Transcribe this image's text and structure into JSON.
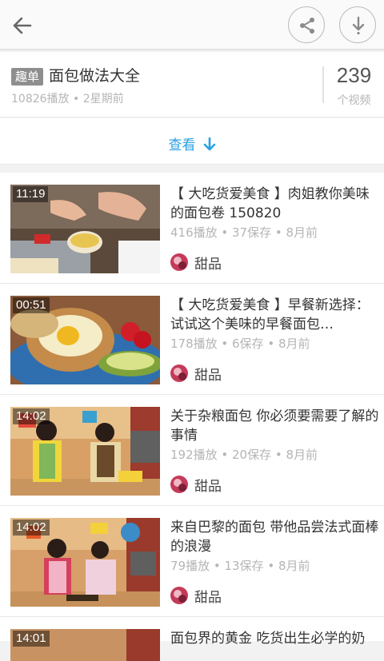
{
  "header": {
    "back_icon": "arrow-left-icon",
    "share_icon": "share-icon",
    "download_icon": "download-icon"
  },
  "playlist": {
    "tag": "趣单",
    "title": "面包做法大全",
    "meta": "10826播放 • 2星期前",
    "count": "239",
    "count_label": "个视频"
  },
  "more": {
    "label": "查看",
    "icon": "arrow-down-icon"
  },
  "videos": [
    {
      "duration": "11:19",
      "title": "【 大吃货爱美食 】肉姐教你美味的面包卷 150820",
      "meta": "416播放 • 37保存 • 8月前",
      "channel": "甜品"
    },
    {
      "duration": "00:51",
      "title": "【 大吃货爱美食 】早餐新选择：试试这个美味的早餐面包…",
      "meta": "178播放 • 6保存 • 8月前",
      "channel": "甜品"
    },
    {
      "duration": "14:02",
      "title": "关于杂粮面包 你必须要需要了解的事情",
      "meta": "192播放 • 20保存 • 8月前",
      "channel": "甜品"
    },
    {
      "duration": "14:02",
      "title": "来自巴黎的面包 带他品尝法式面棒的浪漫",
      "meta": "79播放 • 13保存 • 8月前",
      "channel": "甜品"
    },
    {
      "duration": "14:01",
      "title": "面包界的黄金 吃货出生必学的奶",
      "meta": "",
      "channel": ""
    }
  ],
  "colors": {
    "accent": "#2aa0e6",
    "tag_bg": "#8e8e8e",
    "meta_text": "#b5b5b5"
  }
}
